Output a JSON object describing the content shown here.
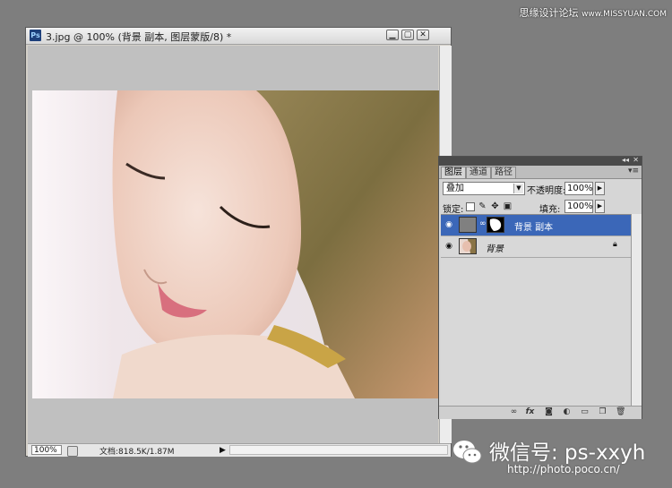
{
  "site_watermark": {
    "name": "思缘设计论坛",
    "url": "www.MISSYUAN.COM"
  },
  "document": {
    "app_icon": "Ps",
    "title": "3.jpg @ 100% (背景 副本, 图层蒙版/8) *",
    "zoom": "100%",
    "info": "文档:818.5K/1.87M"
  },
  "layers_panel": {
    "tabs": [
      "图层",
      "通道",
      "路径"
    ],
    "blend_mode": "叠加",
    "opacity_label": "不透明度:",
    "opacity": "100%",
    "lock_label": "锁定:",
    "fill_label": "填充:",
    "fill": "100%",
    "layers": [
      {
        "name": "背景 副本",
        "selected": true,
        "has_mask": true
      },
      {
        "name": "背景",
        "selected": false,
        "locked": true
      }
    ],
    "footer_icons": [
      "link-icon",
      "fx-icon",
      "mask-icon",
      "adjustment-icon",
      "folder-icon",
      "new-layer-icon",
      "trash-icon"
    ]
  },
  "bottom_watermark": {
    "wechat": "微信号: ps-xxyh",
    "url": "http://photo.poco.cn/"
  },
  "colors": {
    "selection": "#3b67b8",
    "workspace": "#7e7e7e"
  }
}
